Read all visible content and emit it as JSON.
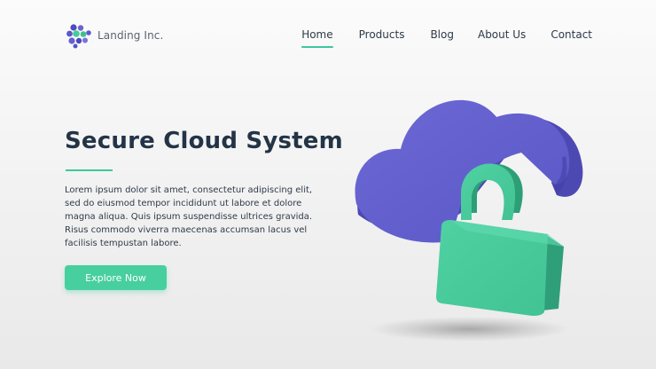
{
  "brand": {
    "logo_icon": "flower-dots-icon",
    "name": "Landing Inc."
  },
  "nav": {
    "items": [
      {
        "label": "Home",
        "active": true
      },
      {
        "label": "Products",
        "active": false
      },
      {
        "label": "Blog",
        "active": false
      },
      {
        "label": "About Us",
        "active": false
      },
      {
        "label": "Contact",
        "active": false
      }
    ]
  },
  "hero": {
    "title": "Secure Cloud System",
    "body": "Lorem ipsum dolor sit amet, consectetur adipiscing elit, sed do eiusmod tempor incididunt ut labore et dolore magna aliqua. Quis ipsum suspendisse ultrices gravida. Risus commodo viverra maecenas accumsan lacus vel facilisis tempustan labore.",
    "cta_label": "Explore Now"
  },
  "illustration": {
    "icons": [
      "cloud-icon",
      "padlock-icon"
    ]
  },
  "colors": {
    "accent": "#48cf9f",
    "cloud": "#6260cc",
    "lock": "#45c99c",
    "heading": "#243447"
  }
}
